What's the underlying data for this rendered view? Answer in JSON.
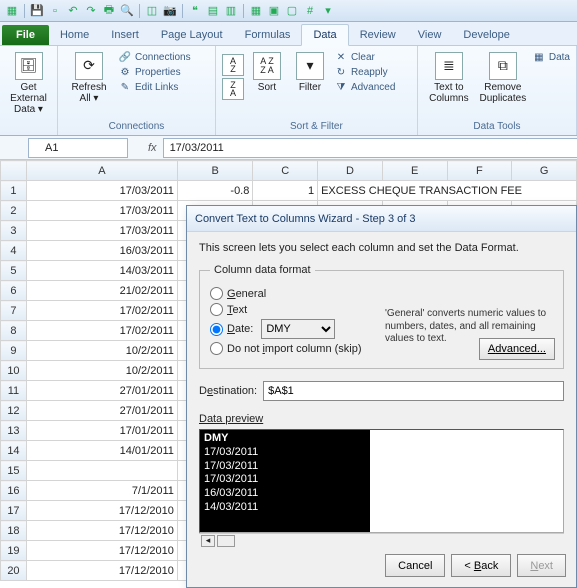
{
  "tabs": {
    "file": "File",
    "list": [
      "Home",
      "Insert",
      "Page Layout",
      "Formulas",
      "Data",
      "Review",
      "View",
      "Develope"
    ],
    "active_index": 4
  },
  "ribbon": {
    "get_external": {
      "label": "Get External\nData ▾"
    },
    "refresh": {
      "label": "Refresh\nAll ▾"
    },
    "conn_items": [
      "Connections",
      "Properties",
      "Edit Links"
    ],
    "group_connections": "Connections",
    "sort_label": "Sort",
    "filter_label": "Filter",
    "clear": "Clear",
    "reapply": "Reapply",
    "advanced": "Advanced",
    "group_sortfilter": "Sort & Filter",
    "text_to_columns": "Text to\nColumns",
    "remove_dup": "Remove\nDuplicates",
    "data_v": "Data",
    "group_datatools": "Data Tools"
  },
  "fbar": {
    "name": "A1",
    "fx": "fx",
    "formula": "17/03/2011"
  },
  "grid": {
    "cols": [
      "A",
      "B",
      "C",
      "D",
      "E",
      "F",
      "G"
    ],
    "rows": [
      {
        "n": 1,
        "A": "17/03/2011",
        "B": "-0.8",
        "C": "1",
        "rest": "EXCESS CHEQUE TRANSACTION FEE"
      },
      {
        "n": 2,
        "A": "17/03/2011"
      },
      {
        "n": 3,
        "A": "17/03/2011"
      },
      {
        "n": 4,
        "A": "16/03/2011"
      },
      {
        "n": 5,
        "A": "14/03/2011"
      },
      {
        "n": 6,
        "A": "21/02/2011"
      },
      {
        "n": 7,
        "A": "17/02/2011"
      },
      {
        "n": 8,
        "A": "17/02/2011"
      },
      {
        "n": 9,
        "A": "10/2/2011"
      },
      {
        "n": 10,
        "A": "10/2/2011"
      },
      {
        "n": 11,
        "A": "27/01/2011"
      },
      {
        "n": 12,
        "A": "27/01/2011"
      },
      {
        "n": 13,
        "A": "17/01/2011"
      },
      {
        "n": 14,
        "A": "14/01/2011"
      },
      {
        "n": 15,
        "A": ""
      },
      {
        "n": 16,
        "A": "7/1/2011"
      },
      {
        "n": 17,
        "A": "17/12/2010"
      },
      {
        "n": 18,
        "A": "17/12/2010"
      },
      {
        "n": 19,
        "A": "17/12/2010"
      },
      {
        "n": 20,
        "A": "17/12/2010"
      }
    ]
  },
  "dialog": {
    "title": "Convert Text to Columns Wizard - Step 3 of 3",
    "intro": "This screen lets you select each column and set the Data Format.",
    "cdf_legend": "Column data format",
    "opt_general": "General",
    "opt_text": "Text",
    "opt_date": "Date:",
    "date_format": "DMY",
    "opt_skip": "Do not import column (skip)",
    "convert_note": "'General' converts numeric values to numbers, dates, and all remaining values to text.",
    "advanced_btn": "Advanced...",
    "dest_label": "Destination:",
    "dest_value": "$A$1",
    "preview_label": "Data preview",
    "preview_header": "DMY",
    "preview_rows": [
      "17/03/2011",
      "17/03/2011",
      "17/03/2011",
      "16/03/2011",
      "14/03/2011"
    ],
    "btn_cancel": "Cancel",
    "btn_back": "Back",
    "btn_next": "Next"
  }
}
